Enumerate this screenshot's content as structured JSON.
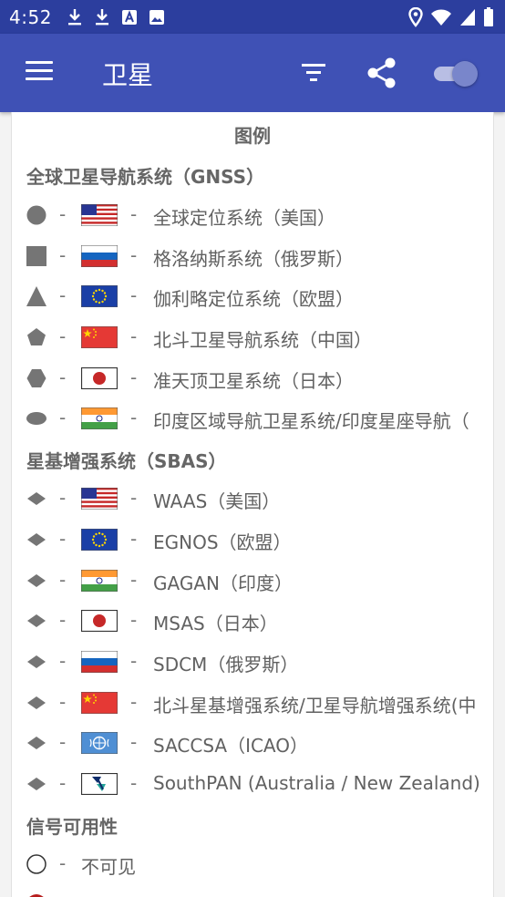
{
  "status_bar": {
    "time": "4:52",
    "left_icons": [
      "download-icon",
      "download-icon",
      "text-notification-icon",
      "image-notification-icon"
    ],
    "right_icons": [
      "location-icon",
      "wifi-icon",
      "signal-icon",
      "battery-icon"
    ]
  },
  "app_bar": {
    "title": "卫星",
    "actions": [
      "menu-icon",
      "filter-icon",
      "share-icon",
      "toggle-switch"
    ],
    "toggle_on": true
  },
  "legend": {
    "title": "图例",
    "gnss": {
      "title": "全球卫星导航系统（GNSS）",
      "items": [
        {
          "symbol": "circle",
          "flag": "us",
          "label": "全球定位系统（美国）"
        },
        {
          "symbol": "square",
          "flag": "ru",
          "label": "格洛纳斯系统（俄罗斯）"
        },
        {
          "symbol": "triangle",
          "flag": "eu",
          "label": "伽利略定位系统（欧盟）"
        },
        {
          "symbol": "pentagon",
          "flag": "cn",
          "label": "北斗卫星导航系统（中国）"
        },
        {
          "symbol": "hexagon",
          "flag": "jp",
          "label": "准天顶卫星系统（日本）"
        },
        {
          "symbol": "ellipse",
          "flag": "in",
          "label": "印度区域导航卫星系统/印度星座导航（"
        }
      ]
    },
    "sbas": {
      "title": "星基增强系统（SBAS）",
      "items": [
        {
          "symbol": "diamond",
          "flag": "us",
          "label": "WAAS（美国）"
        },
        {
          "symbol": "diamond",
          "flag": "eu",
          "label": "EGNOS（欧盟）"
        },
        {
          "symbol": "diamond",
          "flag": "in",
          "label": "GAGAN（印度）"
        },
        {
          "symbol": "diamond",
          "flag": "jp",
          "label": "MSAS（日本）"
        },
        {
          "symbol": "diamond",
          "flag": "ru",
          "label": "SDCM（俄罗斯）"
        },
        {
          "symbol": "diamond",
          "flag": "cn",
          "label": "北斗星基增强系统/卫星导航增强系统(中"
        },
        {
          "symbol": "diamond",
          "flag": "icao",
          "label": "SACCSA（ICAO）"
        },
        {
          "symbol": "diamond",
          "flag": "southpan",
          "label": "SouthPAN (Australia / New Zealand)"
        }
      ]
    },
    "availability": {
      "title": "信号可用性",
      "items": [
        {
          "symbol": "circle-outline",
          "label": "不可见"
        }
      ]
    }
  },
  "colors": {
    "status_bar": "#2c3e9e",
    "app_bar": "#3f51b5",
    "symbol": "#757575",
    "text": "#616161",
    "heading": "#666666"
  }
}
